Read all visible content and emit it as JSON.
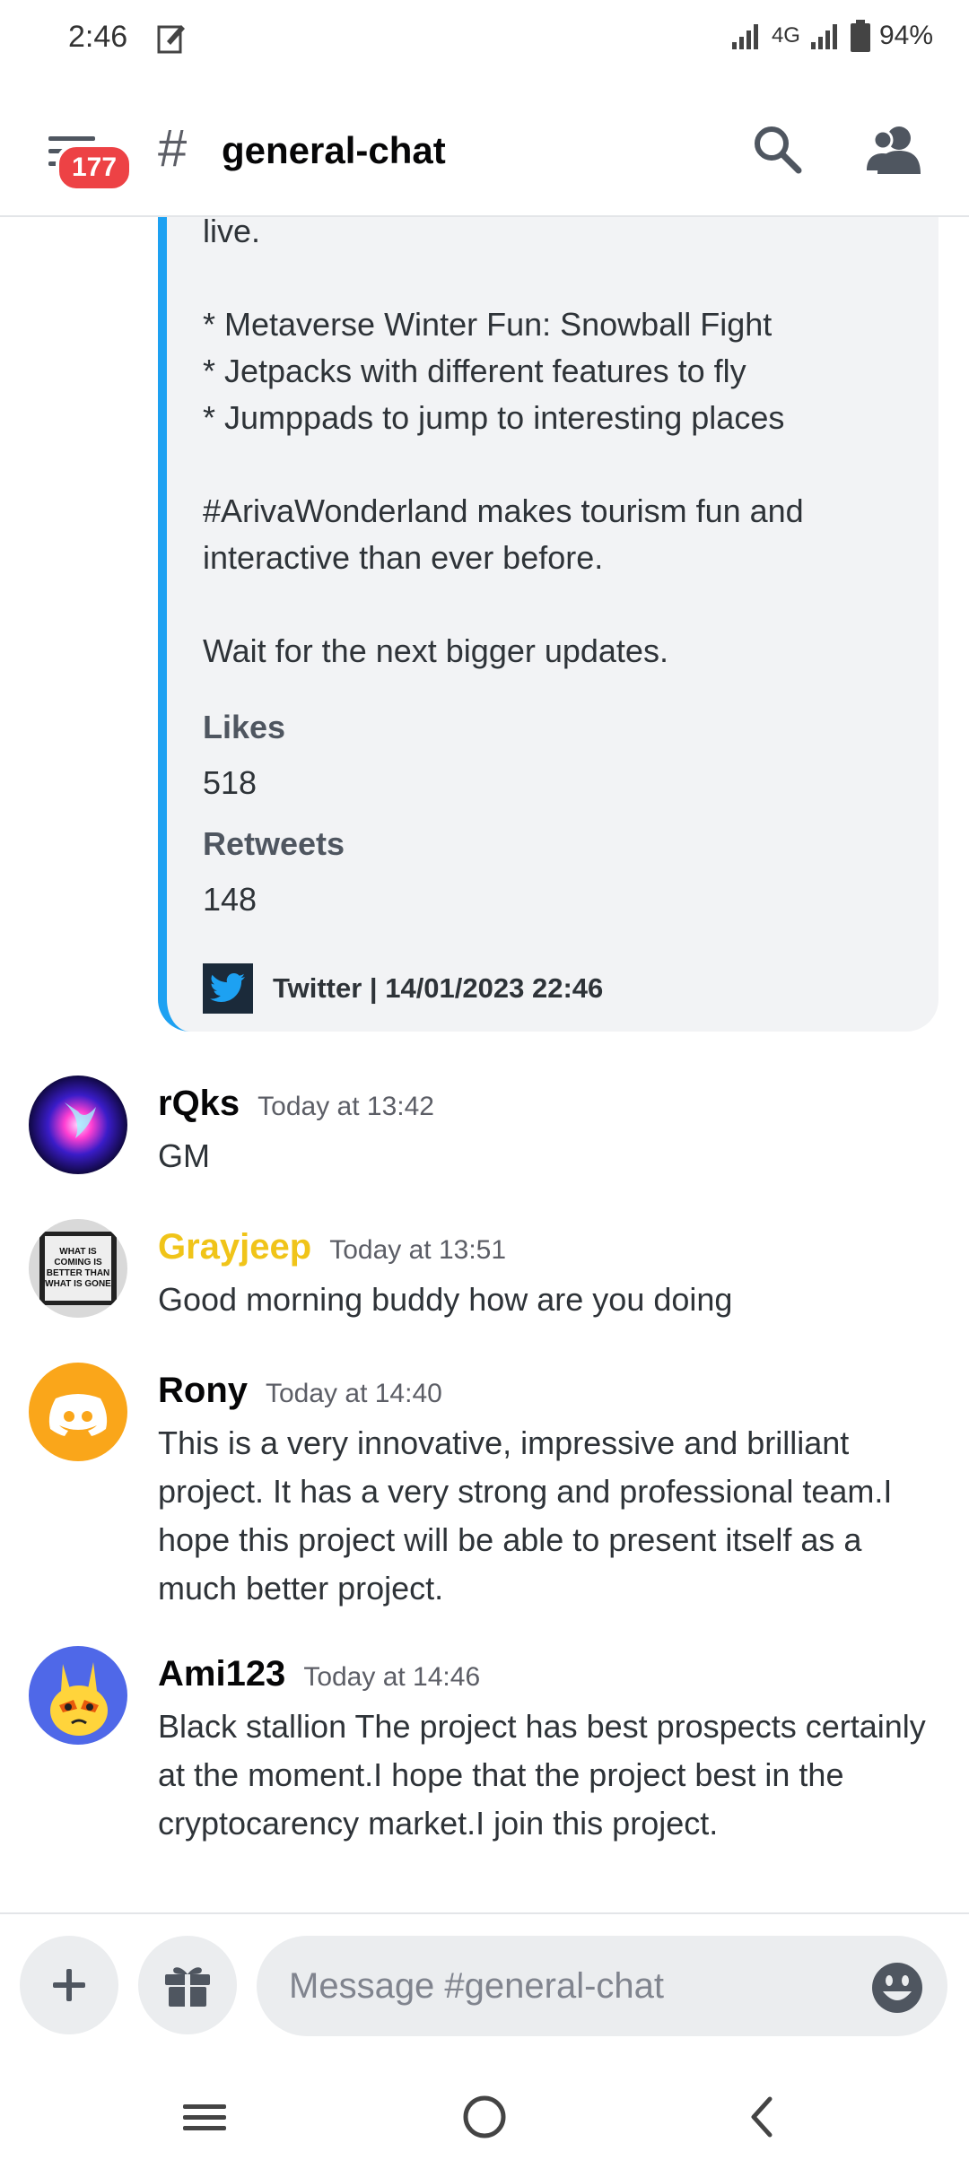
{
  "status_bar": {
    "time": "2:46",
    "network": "4G",
    "battery": "94%"
  },
  "header": {
    "badge_count": "177",
    "channel_hash": "#",
    "channel_name": "general-chat"
  },
  "embed": {
    "description": "live.\n\n* Metaverse Winter Fun: Snowball Fight\n* Jetpacks with different features to fly\n* Jumppads to jump to interesting places\n\n#ArivaWonderland makes tourism fun and interactive than ever before.\n\nWait for the next bigger updates.",
    "fields": [
      {
        "name": "Likes",
        "value": "518"
      },
      {
        "name": "Retweets",
        "value": "148"
      }
    ],
    "footer": "Twitter | 14/01/2023 22:46",
    "accent_color": "#1da1f2"
  },
  "messages": [
    {
      "author": "rQks",
      "author_color": "#060607",
      "timestamp": "Today at 13:42",
      "text": "GM"
    },
    {
      "author": "Grayjeep",
      "author_color": "#f0c419",
      "timestamp": "Today at 13:51",
      "text": "Good morning buddy how are you doing",
      "avatar_text": "WHAT IS COMING IS BETTER THAN WHAT IS GONE"
    },
    {
      "author": "Rony",
      "author_color": "#060607",
      "timestamp": "Today at 14:40",
      "text": "This is a very innovative, impressive  and brilliant project. It has a very strong and professional team.I hope this project will be able to present itself as a much better project."
    },
    {
      "author": "Ami123",
      "author_color": "#060607",
      "timestamp": "Today at 14:46",
      "text": "Black stallion The project has best prospects certainly at the moment.I hope that the project best in the cryptocarency market.I join this project."
    }
  ],
  "composer": {
    "placeholder": "Message #general-chat"
  },
  "icons": {
    "menu": "channel-list-icon",
    "search": "search-icon",
    "members": "members-icon",
    "add": "plus-icon",
    "gift": "gift-icon",
    "emoji": "emoji-icon",
    "nav_recents": "recents-icon",
    "nav_home": "home-icon",
    "nav_back": "back-icon"
  }
}
